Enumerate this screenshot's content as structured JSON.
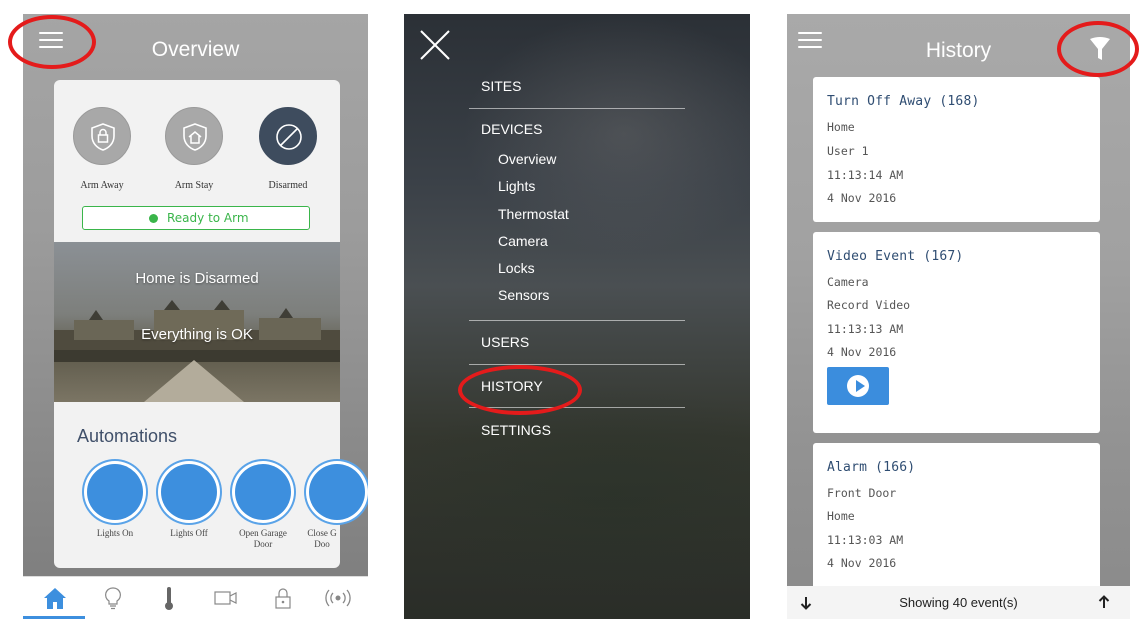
{
  "overview": {
    "title": "Overview",
    "arm_buttons": [
      {
        "label": "Arm Away",
        "icon": "shield-lock-icon"
      },
      {
        "label": "Arm Stay",
        "icon": "shield-home-icon"
      },
      {
        "label": "Disarmed",
        "icon": "disarmed-slash-icon"
      }
    ],
    "ready_status": "Ready to Arm",
    "home_status": "Home is Disarmed",
    "ok_status": "Everything is OK",
    "automations_title": "Automations",
    "automations": [
      {
        "label": "Lights On"
      },
      {
        "label": "Lights Off"
      },
      {
        "label": "Open Garage Door"
      },
      {
        "label": "Close G Doo"
      }
    ],
    "tabs": [
      "home-icon",
      "lightbulb-icon",
      "thermometer-icon",
      "camera-icon",
      "lock-icon",
      "sensor-icon"
    ],
    "colors": {
      "accent": "#3d8fde",
      "ready": "#3ab54a",
      "disarmed": "#3e4c5e"
    }
  },
  "menu": {
    "sections": [
      {
        "label": "SITES"
      },
      {
        "label": "DEVICES",
        "items": [
          "Overview",
          "Lights",
          "Thermostat",
          "Camera",
          "Locks",
          "Sensors"
        ]
      },
      {
        "label": "USERS"
      },
      {
        "label": "HISTORY"
      },
      {
        "label": "SETTINGS"
      }
    ]
  },
  "history": {
    "title": "History",
    "events": [
      {
        "title": "Turn Off Away (168)",
        "lines": [
          "Home",
          "User 1",
          "11:13:14 AM",
          "4 Nov 2016"
        ]
      },
      {
        "title": "Video Event (167)",
        "lines": [
          "Camera",
          "Record Video",
          "11:13:13 AM",
          "4 Nov 2016"
        ],
        "has_video": true
      },
      {
        "title": "Alarm (166)",
        "lines": [
          "Front Door",
          "Home",
          "11:13:03 AM",
          "4 Nov 2016"
        ]
      }
    ],
    "footer": "Showing 40 event(s)",
    "colors": {
      "title": "#2f4d72",
      "play": "#3b8ddd"
    }
  },
  "annotation_color": "#e41b1b"
}
